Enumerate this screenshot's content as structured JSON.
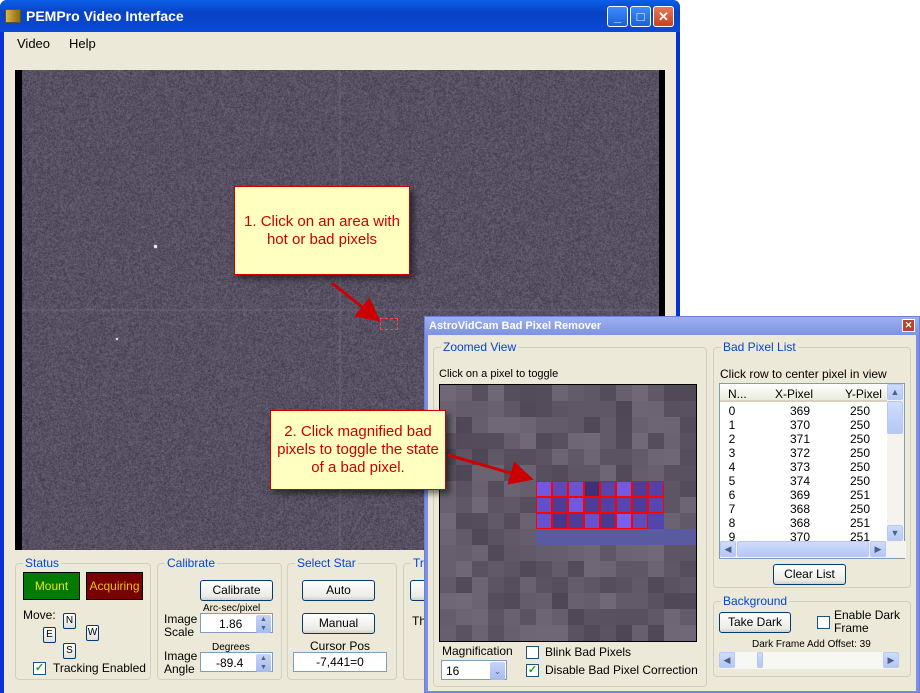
{
  "main_window": {
    "title": "PEMPro Video Interface",
    "controls": {
      "minimize": "_",
      "maximize": "□",
      "close": "✕"
    },
    "menu": [
      "Video",
      "Help"
    ]
  },
  "callouts": [
    "1. Click on an area with hot or bad pixels",
    "2. Click magnified bad pixels to toggle the state of a bad pixel."
  ],
  "status": {
    "legend": "Status",
    "mount": "Mount",
    "acquiring": "Acquiring",
    "move_label": "Move:",
    "dirs": {
      "n": "N",
      "e": "E",
      "w": "W",
      "s": "S"
    },
    "tracking_label": "Tracking Enabled",
    "tracking_checked": true,
    "colors": {
      "mount_bg": "#007a00",
      "mount_fg": "#e8e800",
      "acquiring_bg": "#7a0000",
      "acquiring_fg": "#e8c000"
    }
  },
  "calibrate": {
    "legend": "Calibrate",
    "button": "Calibrate",
    "scale_unit": "Arc-sec/pixel",
    "scale_label": "Image Scale",
    "scale_value": "1.86",
    "angle_unit": "Degrees",
    "angle_label": "Image Angle",
    "angle_value": "-89.4"
  },
  "select_star": {
    "legend": "Select Star",
    "auto": "Auto",
    "manual": "Manual",
    "cursor_label": "Cursor Pos",
    "cursor_value": "-7,441=0"
  },
  "partial": {
    "legend": "Tra",
    "label": "Th"
  },
  "dialog": {
    "title": "AstroVidCam Bad Pixel Remover",
    "close": "✕",
    "zoomed": {
      "legend": "Zoomed View",
      "hint": "Click on a pixel to toggle",
      "magnification_label": "Magnification",
      "magnification_value": "16",
      "blink_label": "Blink Bad Pixels",
      "blink_checked": false,
      "disable_label": "Disable Bad Pixel Correction",
      "disable_checked": true
    },
    "list": {
      "legend": "Bad Pixel List",
      "hint": "Click row to center pixel in view",
      "columns": [
        "N...",
        "X-Pixel",
        "Y-Pixel"
      ],
      "rows": [
        [
          "0",
          "369",
          "250"
        ],
        [
          "1",
          "370",
          "250"
        ],
        [
          "2",
          "371",
          "250"
        ],
        [
          "3",
          "372",
          "250"
        ],
        [
          "4",
          "373",
          "250"
        ],
        [
          "5",
          "374",
          "250"
        ],
        [
          "6",
          "369",
          "251"
        ],
        [
          "7",
          "368",
          "250"
        ],
        [
          "8",
          "368",
          "251"
        ],
        [
          "9",
          "370",
          "251"
        ]
      ],
      "clear": "Clear List"
    },
    "background": {
      "legend": "Background",
      "take_dark": "Take Dark",
      "enable_label": "Enable Dark Frame",
      "enable_checked": false,
      "offset_label": "Dark Frame Add Offset: 39",
      "offset_value": 39
    }
  }
}
